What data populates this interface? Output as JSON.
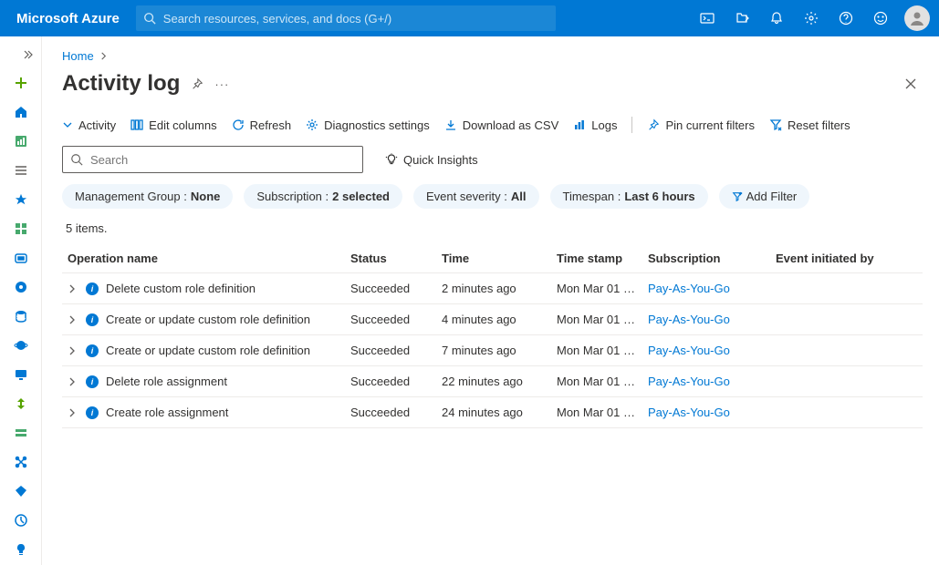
{
  "brand": "Microsoft Azure",
  "search_placeholder": "Search resources, services, and docs (G+/)",
  "breadcrumb": {
    "home": "Home"
  },
  "page_title": "Activity log",
  "toolbar": {
    "activity": "Activity",
    "edit_columns": "Edit columns",
    "refresh": "Refresh",
    "diagnostics": "Diagnostics settings",
    "download_csv": "Download as CSV",
    "logs": "Logs",
    "pin": "Pin current filters",
    "reset": "Reset filters"
  },
  "local_search_placeholder": "Search",
  "quick_insights": "Quick Insights",
  "chips": {
    "mg_label": "Management Group : ",
    "mg_value": "None",
    "sub_label": "Subscription : ",
    "sub_value": "2 selected",
    "sev_label": "Event severity : ",
    "sev_value": "All",
    "time_label": "Timespan : ",
    "time_value": "Last 6 hours",
    "add_filter": "Add Filter"
  },
  "items_count": "5 items.",
  "columns": {
    "op": "Operation name",
    "status": "Status",
    "time": "Time",
    "ts": "Time stamp",
    "sub": "Subscription",
    "init": "Event initiated by"
  },
  "rows": [
    {
      "op": "Delete custom role definition",
      "status": "Succeeded",
      "time": "2 minutes ago",
      "ts": "Mon Mar 01 …",
      "sub": "Pay-As-You-Go",
      "init": ""
    },
    {
      "op": "Create or update custom role definition",
      "status": "Succeeded",
      "time": "4 minutes ago",
      "ts": "Mon Mar 01 …",
      "sub": "Pay-As-You-Go",
      "init": ""
    },
    {
      "op": "Create or update custom role definition",
      "status": "Succeeded",
      "time": "7 minutes ago",
      "ts": "Mon Mar 01 …",
      "sub": "Pay-As-You-Go",
      "init": ""
    },
    {
      "op": "Delete role assignment",
      "status": "Succeeded",
      "time": "22 minutes ago",
      "ts": "Mon Mar 01 …",
      "sub": "Pay-As-You-Go",
      "init": ""
    },
    {
      "op": "Create role assignment",
      "status": "Succeeded",
      "time": "24 minutes ago",
      "ts": "Mon Mar 01 …",
      "sub": "Pay-As-You-Go",
      "init": ""
    }
  ],
  "colors": {
    "azure_blue": "#0078d4"
  }
}
